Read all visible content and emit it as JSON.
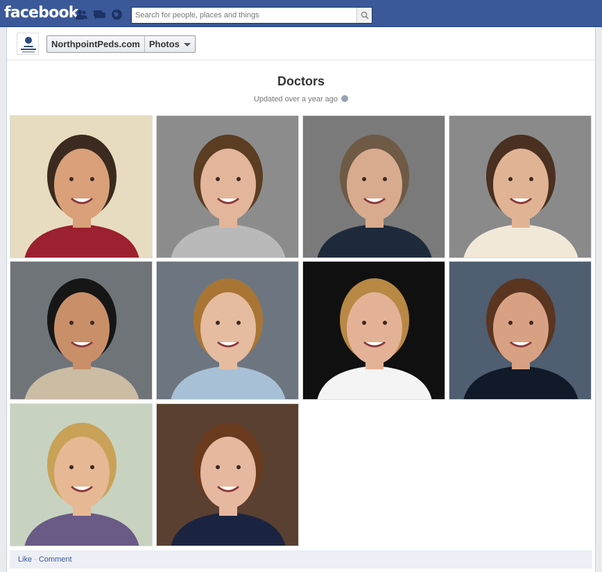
{
  "header": {
    "logo": "facebook",
    "search_placeholder": "Search for people, places and things",
    "icons": [
      "friend-requests-icon",
      "messages-icon",
      "notifications-icon",
      "search-icon"
    ]
  },
  "breadcrumb": {
    "page": "NorthpointPeds.com",
    "section": "Photos"
  },
  "album": {
    "title": "Doctors",
    "updated": "Updated over a year ago",
    "privacy_icon": "globe-icon"
  },
  "photos": [
    {
      "hair": "#3b2a1f",
      "skin": "#d9a07a",
      "bg": "#e8dcc0",
      "shirt": "#9b2030"
    },
    {
      "hair": "#5b3d22",
      "skin": "#e3b59a",
      "bg": "#8c8c8c",
      "shirt": "#b9b9b9"
    },
    {
      "hair": "#6e5a45",
      "skin": "#d8ab8f",
      "bg": "#7a7a7a",
      "shirt": "#1e2a3c"
    },
    {
      "hair": "#4a3020",
      "skin": "#e0b395",
      "bg": "#8a8a8a",
      "shirt": "#f2e8d8"
    },
    {
      "hair": "#161616",
      "skin": "#c98f69",
      "bg": "#6f7479",
      "shirt": "#cbbca4"
    },
    {
      "hair": "#a87535",
      "skin": "#e6bca0",
      "bg": "#6d7680",
      "shirt": "#a7c0d6"
    },
    {
      "hair": "#b88845",
      "skin": "#e3b296",
      "bg": "#101010",
      "shirt": "#f4f4f4"
    },
    {
      "hair": "#5a3520",
      "skin": "#d9a183",
      "bg": "#4f5e70",
      "shirt": "#111a28"
    },
    {
      "hair": "#c9a257",
      "skin": "#e6b894",
      "bg": "#c7d3c0",
      "shirt": "#6a5a86"
    },
    {
      "hair": "#6a3b1e",
      "skin": "#e7b8a0",
      "bg": "#5a4030",
      "shirt": "#1a2440"
    }
  ],
  "footer": {
    "like": "Like",
    "separator": "·",
    "comment": "Comment"
  }
}
